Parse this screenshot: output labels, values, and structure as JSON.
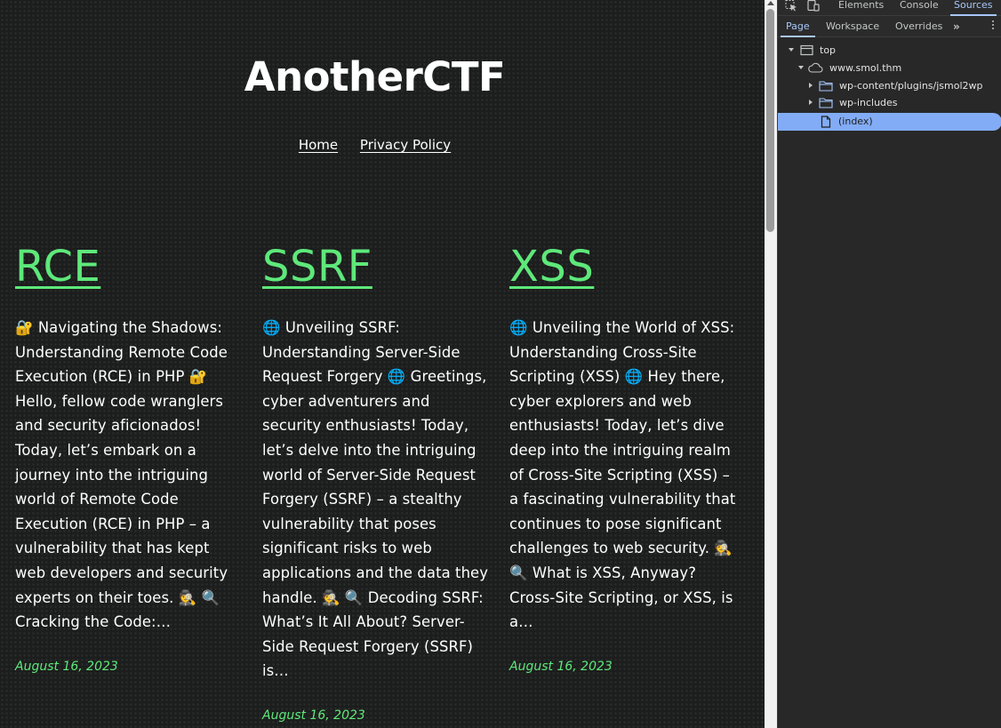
{
  "site": {
    "title": "AnotherCTF",
    "nav": [
      {
        "label": "Home"
      },
      {
        "label": "Privacy Policy"
      }
    ],
    "posts": [
      {
        "title": "RCE",
        "excerpt": "🔐 Navigating the Shadows: Understanding Remote Code Execution (RCE) in PHP 🔐 Hello, fellow code wranglers and security aficionados! Today, let’s embark on a journey into the intriguing world of Remote Code Execution (RCE) in PHP – a vulnerability that has kept web developers and security experts on their toes. 🕵 🔍 Cracking the Code:…",
        "date": "August 16, 2023"
      },
      {
        "title": "SSRF",
        "excerpt": "🌐 Unveiling SSRF: Understanding Server-Side Request Forgery 🌐 Greetings, cyber adventurers and security enthusiasts! Today, let’s delve into the intriguing world of Server-Side Request Forgery (SSRF) – a stealthy vulnerability that poses significant risks to web applications and the data they handle. 🕵 🔍 Decoding SSRF: What’s It All About? Server-Side Request Forgery (SSRF) is…",
        "date": "August 16, 2023"
      },
      {
        "title": "XSS",
        "excerpt": "🌐 Unveiling the World of XSS: Understanding Cross-Site Scripting (XSS) 🌐 Hey there, cyber explorers and web enthusiasts! Today, let’s dive deep into the intriguing realm of Cross-Site Scripting (XSS) – a fascinating vulnerability that continues to pose significant challenges to web security. 🕵 🔍 What is XSS, Anyway? Cross-Site Scripting, or XSS, is a…",
        "date": "August 16, 2023"
      }
    ],
    "colors": {
      "accent": "#5ee87a",
      "background": "#1c1d1d",
      "text": "#ffffff"
    }
  },
  "devtools": {
    "main_tabs": [
      "Elements",
      "Console",
      "Sources"
    ],
    "active_main_tab": "Sources",
    "sub_tabs": [
      "Page",
      "Workspace",
      "Overrides"
    ],
    "active_sub_tab": "Page",
    "tree": [
      {
        "label": "top",
        "icon": "frame-icon"
      },
      {
        "label": "www.smol.thm",
        "icon": "cloud-icon"
      },
      {
        "label": "wp-content/plugins/jsmol2wp",
        "icon": "folder-icon"
      },
      {
        "label": "wp-includes",
        "icon": "folder-icon"
      },
      {
        "label": "(index)",
        "icon": "file-icon",
        "selected": true
      }
    ],
    "colors": {
      "accent": "#a8c7fa",
      "selection": "#82acf5"
    }
  }
}
